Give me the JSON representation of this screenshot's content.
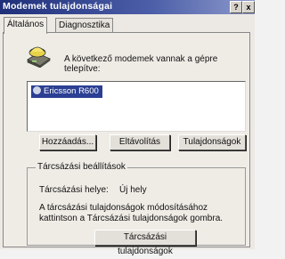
{
  "window": {
    "title": "Modemek tulajdonságai",
    "help_glyph": "?",
    "close_glyph": "x"
  },
  "tabs": [
    {
      "label": "Általános",
      "active": true
    },
    {
      "label": "Diagnosztika",
      "active": false
    }
  ],
  "main": {
    "info_text": "A következő modemek vannak a gépre telepítve:",
    "modems": [
      {
        "name": "Ericsson R600",
        "selected": true
      }
    ]
  },
  "buttons": {
    "add": "Hozzáadás...",
    "remove": "Eltávolítás",
    "properties": "Tulajdonságok"
  },
  "dialing": {
    "group_label": "Tárcsázási beállítások",
    "location_label": "Tárcsázási helye:",
    "location_value": "Új hely",
    "hint_line1": "A tárcsázási tulajdonságok módosításához",
    "hint_line2": "kattintson a Tárcsázási tulajdonságok gombra.",
    "button": "Tárcsázási tulajdonságok"
  },
  "colors": {
    "title_bar": "#1f2f7a",
    "selection": "#2b3f93",
    "dialog_bg": "#ece9e4"
  }
}
